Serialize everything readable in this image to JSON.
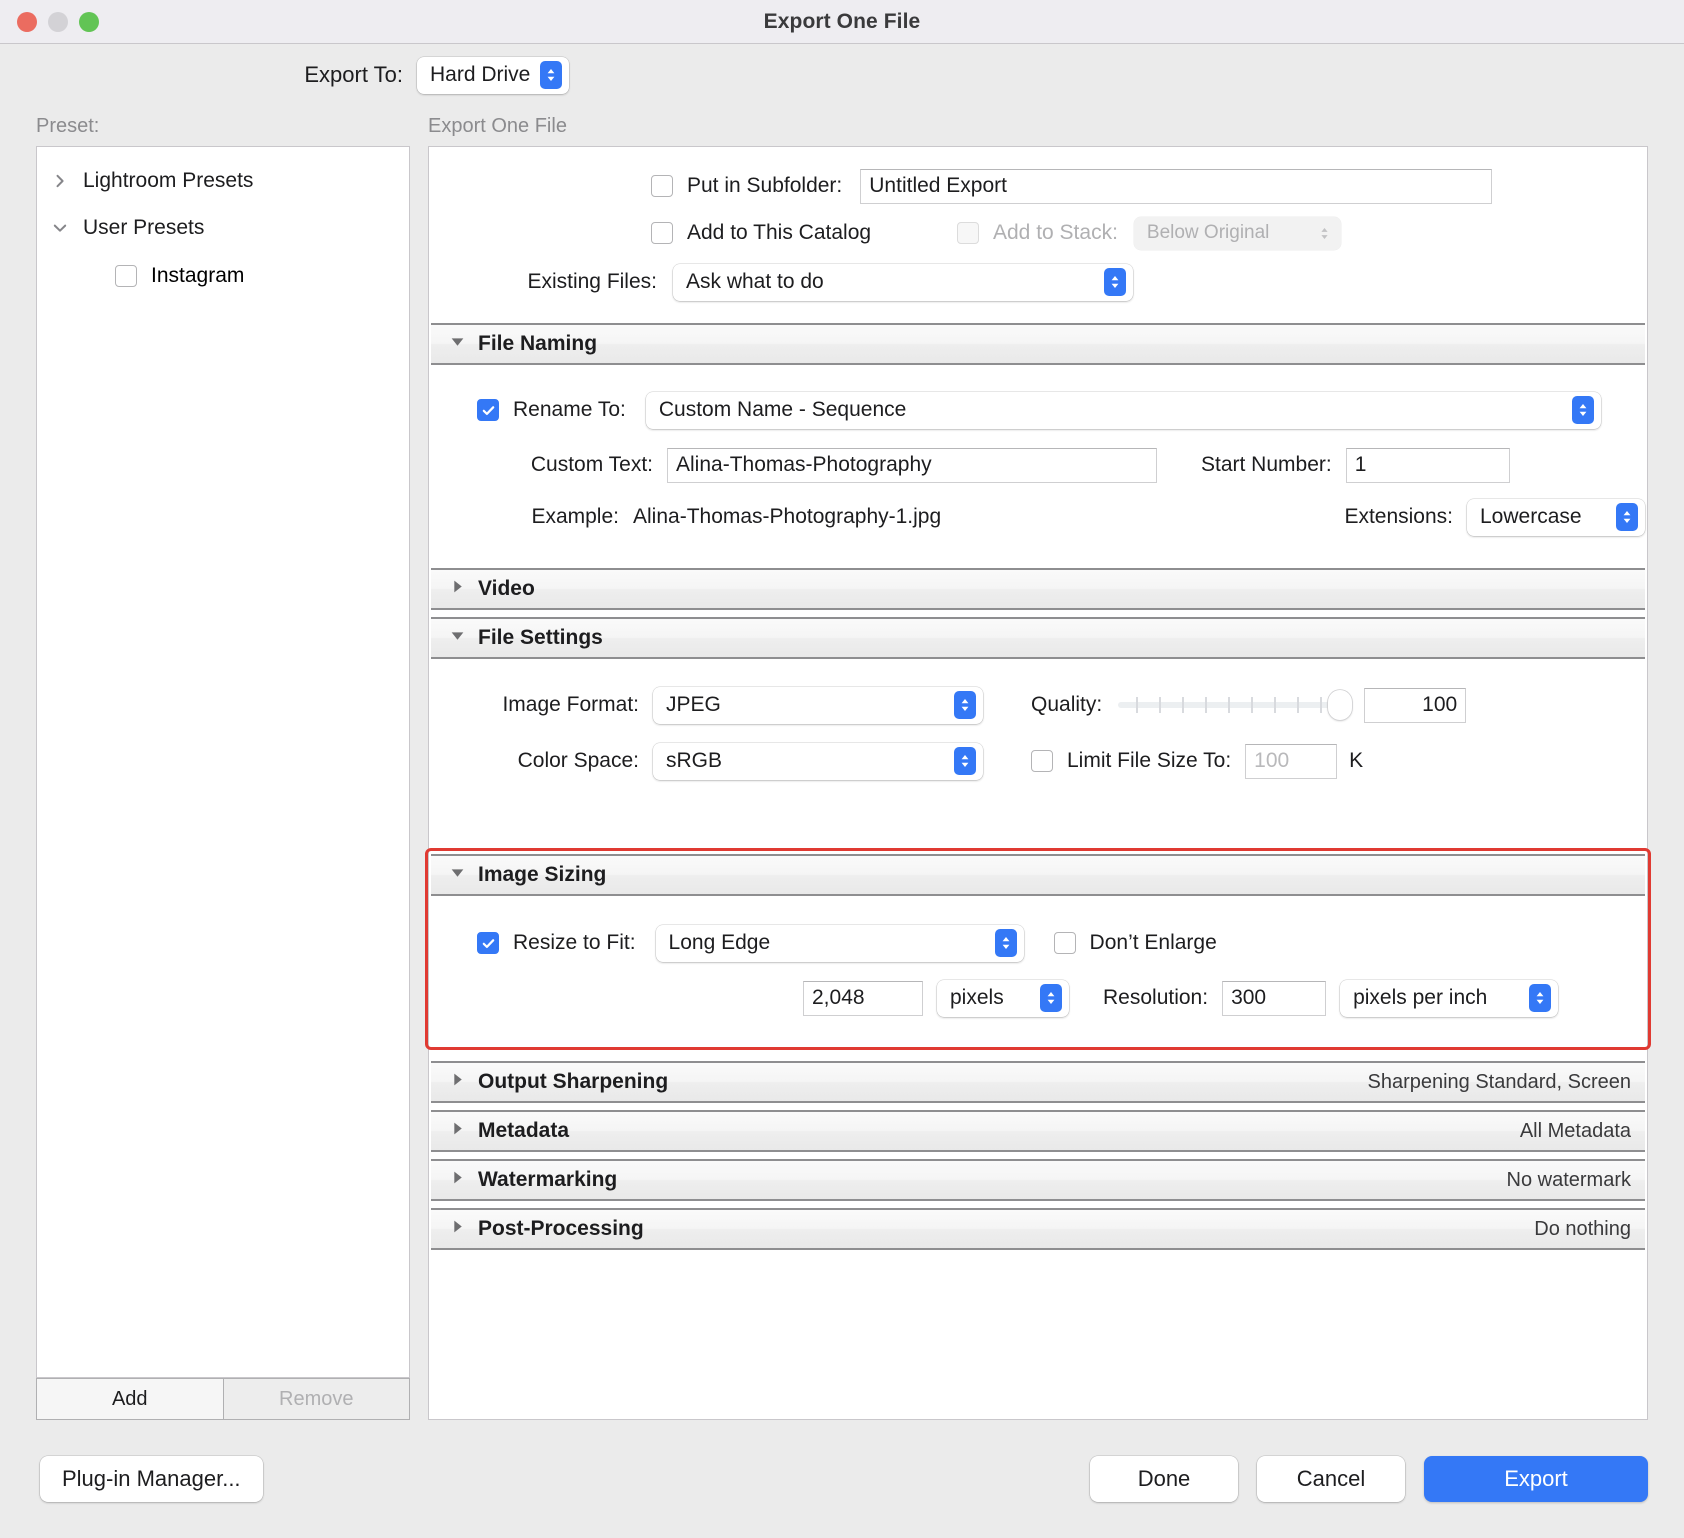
{
  "window": {
    "title": "Export One File",
    "traffic_lights": [
      "close",
      "minimize",
      "zoom"
    ]
  },
  "export_to": {
    "label": "Export To:",
    "value": "Hard Drive"
  },
  "preset_panel": {
    "header": "Preset:",
    "groups": [
      {
        "label": "Lightroom Presets",
        "expanded": false
      },
      {
        "label": "User Presets",
        "expanded": true
      }
    ],
    "items": [
      {
        "label": "Instagram",
        "checked": false
      }
    ],
    "add_label": "Add",
    "remove_label": "Remove"
  },
  "main_panel": {
    "header": "Export One File",
    "put_in_subfolder": {
      "label": "Put in Subfolder:",
      "checked": false,
      "value": "Untitled Export"
    },
    "add_to_catalog": {
      "label": "Add to This Catalog",
      "checked": false
    },
    "add_to_stack": {
      "label": "Add to Stack:",
      "checked": false,
      "enabled": false,
      "value": "Below Original"
    },
    "existing_files": {
      "label": "Existing Files:",
      "value": "Ask what to do"
    },
    "sections": {
      "file_naming": {
        "title": "File Naming",
        "expanded": true,
        "rename_to": {
          "label": "Rename To:",
          "checked": true,
          "value": "Custom Name - Sequence"
        },
        "custom_text": {
          "label": "Custom Text:",
          "value": "Alina-Thomas-Photography"
        },
        "start_number": {
          "label": "Start Number:",
          "value": "1"
        },
        "example": {
          "label": "Example:",
          "value": "Alina-Thomas-Photography-1.jpg"
        },
        "extensions": {
          "label": "Extensions:",
          "value": "Lowercase"
        }
      },
      "video": {
        "title": "Video",
        "expanded": false,
        "summary": ""
      },
      "file_settings": {
        "title": "File Settings",
        "expanded": true,
        "image_format": {
          "label": "Image Format:",
          "value": "JPEG"
        },
        "quality": {
          "label": "Quality:",
          "value": "100",
          "slider_percent": 100
        },
        "color_space": {
          "label": "Color Space:",
          "value": "sRGB"
        },
        "limit_file_size": {
          "label": "Limit File Size To:",
          "checked": false,
          "value": "100",
          "unit": "K"
        }
      },
      "image_sizing": {
        "title": "Image Sizing",
        "expanded": true,
        "highlighted": true,
        "highlight_color": "#e03a32",
        "resize_to_fit": {
          "label": "Resize to Fit:",
          "checked": true,
          "value": "Long Edge"
        },
        "dont_enlarge": {
          "label": "Don’t Enlarge",
          "checked": false
        },
        "size_value": "2,048",
        "size_unit": "pixels",
        "resolution": {
          "label": "Resolution:",
          "value": "300",
          "unit": "pixels per inch"
        }
      },
      "output_sharpening": {
        "title": "Output Sharpening",
        "expanded": false,
        "summary": "Sharpening Standard, Screen"
      },
      "metadata": {
        "title": "Metadata",
        "expanded": false,
        "summary": "All Metadata"
      },
      "watermarking": {
        "title": "Watermarking",
        "expanded": false,
        "summary": "No watermark"
      },
      "post_processing": {
        "title": "Post-Processing",
        "expanded": false,
        "summary": "Do nothing"
      }
    }
  },
  "footer": {
    "plugin_manager": "Plug-in Manager...",
    "done": "Done",
    "cancel": "Cancel",
    "export": "Export",
    "accent": "#3478f6"
  }
}
